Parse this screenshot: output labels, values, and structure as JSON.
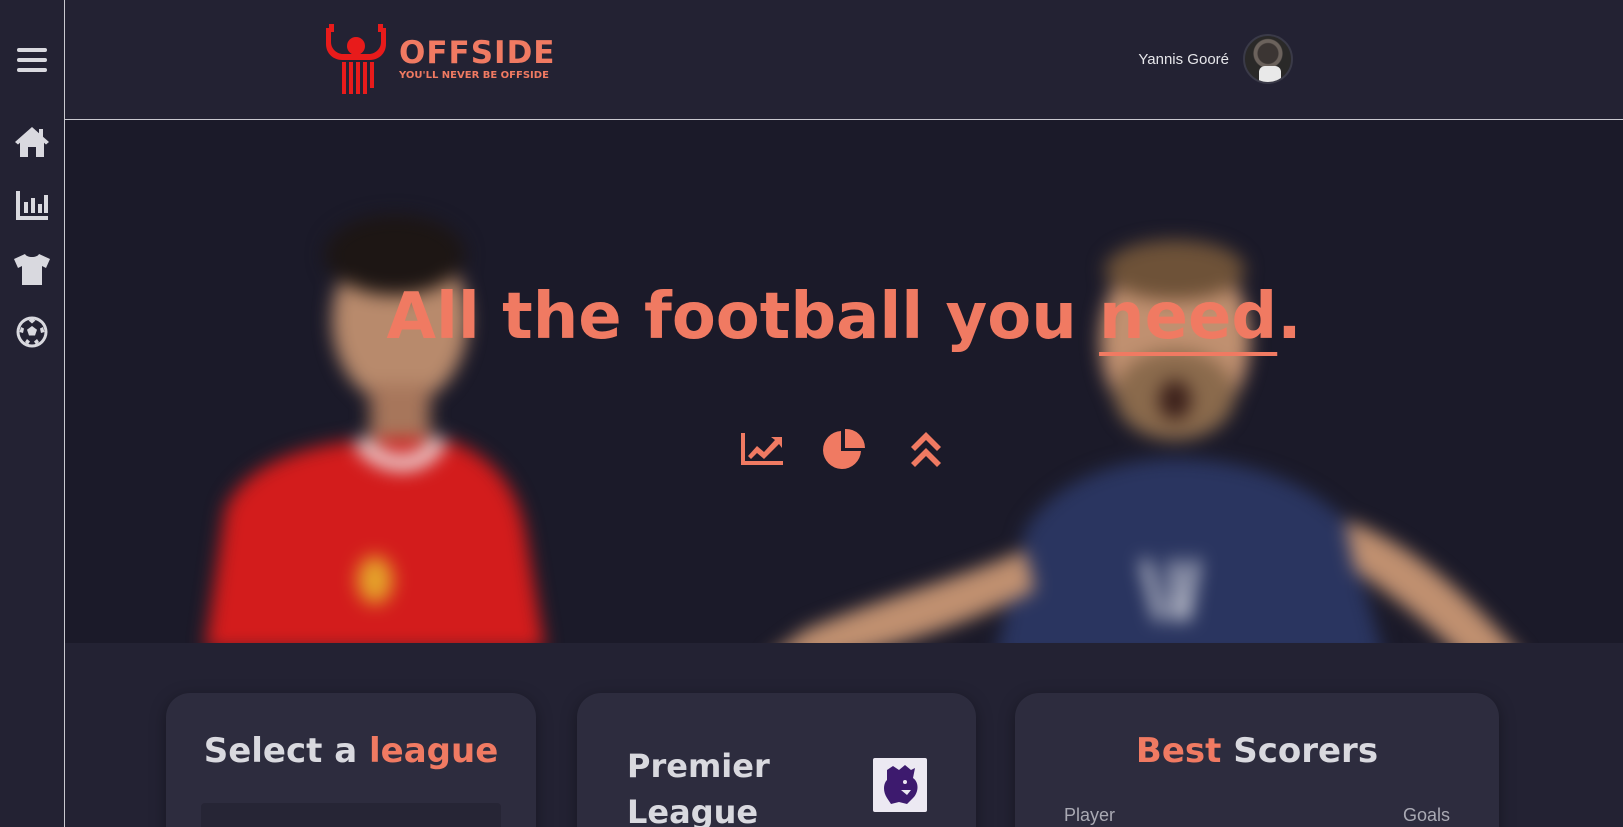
{
  "app": {
    "name": "OFFSIDE",
    "tagline": "YOU'LL NEVER BE OFFSIDE"
  },
  "user": {
    "name": "Yannis Gooré"
  },
  "sidebar": {
    "items": [
      {
        "icon": "menu-icon"
      },
      {
        "icon": "home-icon"
      },
      {
        "icon": "stats-chart-icon"
      },
      {
        "icon": "shirt-icon"
      },
      {
        "icon": "football-icon"
      }
    ]
  },
  "hero": {
    "title_prefix": "All the football you ",
    "title_emphasis": "need",
    "title_suffix": ".",
    "icons": [
      "line-chart-icon",
      "pie-chart-icon",
      "double-chevron-up-icon"
    ]
  },
  "cards": {
    "league_select": {
      "title_plain": "Select a ",
      "title_accent": "league"
    },
    "league_info": {
      "name": "Premier League"
    },
    "scorers": {
      "title_accent": "Best",
      "title_plain": " Scorers",
      "col_player": "Player",
      "col_goals": "Goals"
    }
  },
  "colors": {
    "accent": "#f07a62",
    "background": "#232233",
    "hero_bg": "#1b1a29",
    "card_bg": "#2d2c3e",
    "text": "#d9d9df"
  }
}
